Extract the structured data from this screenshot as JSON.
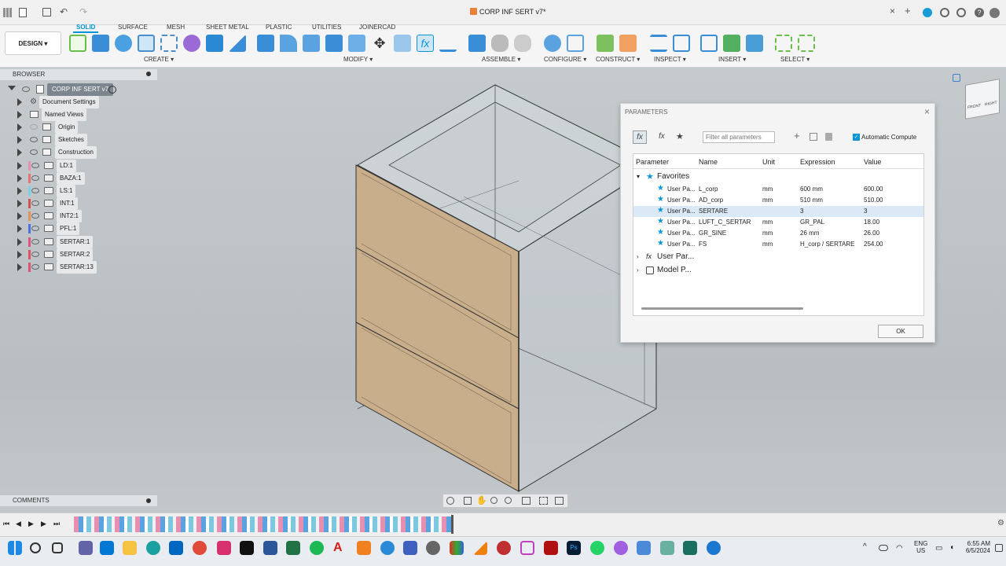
{
  "app": {
    "title": "CORP INF SERT v7*"
  },
  "toolbar": {
    "design_label": "DESIGN",
    "tabs": [
      "SOLID",
      "SURFACE",
      "MESH",
      "SHEET METAL",
      "PLASTIC",
      "UTILITIES",
      "JOINERCAD"
    ],
    "active_tab": "SOLID",
    "groups": [
      "CREATE ▾",
      "MODIFY ▾",
      "ASSEMBLE ▾",
      "CONFIGURE ▾",
      "CONSTRUCT ▾",
      "INSPECT ▾",
      "INSERT ▾",
      "SELECT ▾"
    ]
  },
  "browser": {
    "header": "BROWSER",
    "root": "CORP INF SERT v7",
    "items": [
      {
        "label": "Document Settings",
        "icon": "gear-icon",
        "color": ""
      },
      {
        "label": "Named Views",
        "icon": "folder-icon",
        "color": ""
      },
      {
        "label": "Origin",
        "icon": "folder-icon",
        "color": ""
      },
      {
        "label": "Sketches",
        "icon": "folder-icon",
        "color": ""
      },
      {
        "label": "Construction",
        "icon": "folder-icon",
        "color": ""
      },
      {
        "label": "LD:1",
        "icon": "component-icon",
        "color": "#e88fb0"
      },
      {
        "label": "BAZA:1",
        "icon": "component-icon",
        "color": "#e87070"
      },
      {
        "label": "LS:1",
        "icon": "component-icon",
        "color": "#7ad0e8"
      },
      {
        "label": "INT:1",
        "icon": "component-icon",
        "color": "#d35050"
      },
      {
        "label": "INT2:1",
        "icon": "component-icon",
        "color": "#e89050"
      },
      {
        "label": "PFL:1",
        "icon": "component-icon",
        "color": "#5070e0"
      },
      {
        "label": "SERTAR:1",
        "icon": "component-icon",
        "color": "#e05080"
      },
      {
        "label": "SERTAR:2",
        "icon": "component-icon",
        "color": "#e05060"
      },
      {
        "label": "SERTAR:13",
        "icon": "component-icon",
        "color": "#e05070"
      }
    ]
  },
  "comments": {
    "label": "COMMENTS"
  },
  "parameters": {
    "title": "PARAMETERS",
    "filter_placeholder": "Filter all parameters",
    "auto_compute_label": "Automatic Compute",
    "columns": [
      "Parameter",
      "Name",
      "Unit",
      "Expression",
      "Value"
    ],
    "favorites_label": "Favorites",
    "rows": [
      {
        "param": "User Pa...",
        "name": "L_corp",
        "unit": "mm",
        "expr": "600 mm",
        "value": "600.00"
      },
      {
        "param": "User Pa...",
        "name": "AD_corp",
        "unit": "mm",
        "expr": "510 mm",
        "value": "510.00"
      },
      {
        "param": "User Pa...",
        "name": "SERTARE",
        "unit": "",
        "expr": "3",
        "value": "3"
      },
      {
        "param": "User Pa...",
        "name": "LUFT_C_SERTAR",
        "unit": "mm",
        "expr": "GR_PAL",
        "value": "18.00"
      },
      {
        "param": "User Pa...",
        "name": "GR_SINE",
        "unit": "mm",
        "expr": "26 mm",
        "value": "26.00"
      },
      {
        "param": "User Pa...",
        "name": "FS",
        "unit": "mm",
        "expr": "H_corp / SERTARE",
        "value": "254.00"
      }
    ],
    "user_params_label": "User Par...",
    "model_params_label": "Model P...",
    "ok_label": "OK"
  },
  "viewcube": {
    "front": "FRONT",
    "right": "RIGHT"
  },
  "taskbar": {
    "lang": "ENG",
    "region": "US",
    "time": "6:55 AM",
    "date": "6/5/2024"
  },
  "colors": {
    "accent": "#0696d7",
    "drawer_face": "#c9ae8c"
  }
}
